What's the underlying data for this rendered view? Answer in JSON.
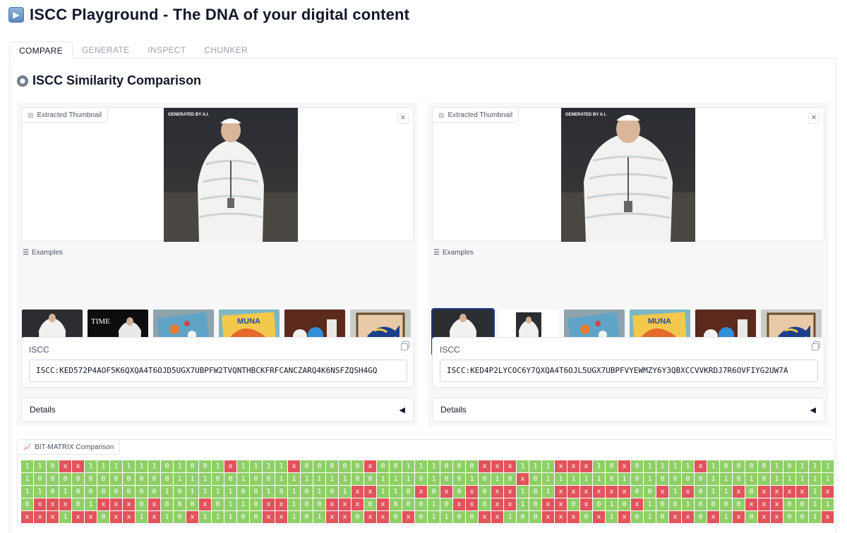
{
  "header": {
    "icon": "play-button-icon",
    "title": "ISCC Playground - The DNA of your digital content"
  },
  "tabs": [
    {
      "label": "COMPARE",
      "active": true
    },
    {
      "label": "GENERATE"
    },
    {
      "label": "INSPECT"
    },
    {
      "label": "CHUNKER"
    }
  ],
  "section": {
    "title": "ISCC Similarity Comparison",
    "icon": "gear-icon"
  },
  "left": {
    "thumbnail_label": "Extracted Thumbnail",
    "thumb_caption": "GENERATED BY A.I.",
    "examples_label": "Examples",
    "iscc_label": "ISCC",
    "iscc_value": "ISCC:KED572P4AOF5K6QXQA4T6OJD5UGX7UBPFW2TVQNTHBCKFRFCANCZARQ4K6NSFZQSH4GQ",
    "details_label": "Details"
  },
  "right": {
    "thumbnail_label": "Extracted Thumbnail",
    "thumb_caption": "GENERATED BY A.I.",
    "examples_label": "Examples",
    "iscc_label": "ISCC",
    "iscc_value": "ISCC:KED4P2LYCOC6Y7QXQA4T6OJL5UGX7UBPFVYEWMZY6Y3QBXCCVVKRDJ7R6OVFIYG2UW7A",
    "details_label": "Details"
  },
  "examples_left": [
    {
      "name": "pope-puffer",
      "caption": ""
    },
    {
      "name": "time-cover",
      "caption": "TIME"
    },
    {
      "name": "blue-board",
      "caption": ""
    },
    {
      "name": "muna-book",
      "caption": "MUNA"
    },
    {
      "name": "shelf-figurines",
      "caption": ""
    },
    {
      "name": "fish-frame",
      "caption": ""
    }
  ],
  "examples_right": [
    {
      "name": "pope-puffer",
      "caption": "",
      "selected": true
    },
    {
      "name": "pope-small",
      "caption": ""
    },
    {
      "name": "blue-board",
      "caption": ""
    },
    {
      "name": "muna-book",
      "caption": "MUNA"
    },
    {
      "name": "shelf-figurines",
      "caption": ""
    },
    {
      "name": "fish-frame",
      "caption": ""
    }
  ],
  "bitmatrix": {
    "label": "BIT-MATRIX Comparison",
    "rows": [
      "110xx11111101001x1111x00000x00111000xxx111xxx10x01111x1000010111",
      "100000000000111001001111110011101001010x011111010100001101011111",
      "11010000000101111001010101xx110x0x0x0xx101xxxxxx00x1x011x0xxxx1x0",
      "0xxx01xxx0x000x0110xx100xxx0x00010xx0xx10xx0x010x10010000xxx0011",
      "xxx1xx0xx1x10x11100xx101xx0xx0x01100xx100xxx0x1x010xx0x1x0xx001x"
    ]
  },
  "colors": {
    "match": "#8fcf68",
    "diff": "#e2535b"
  }
}
